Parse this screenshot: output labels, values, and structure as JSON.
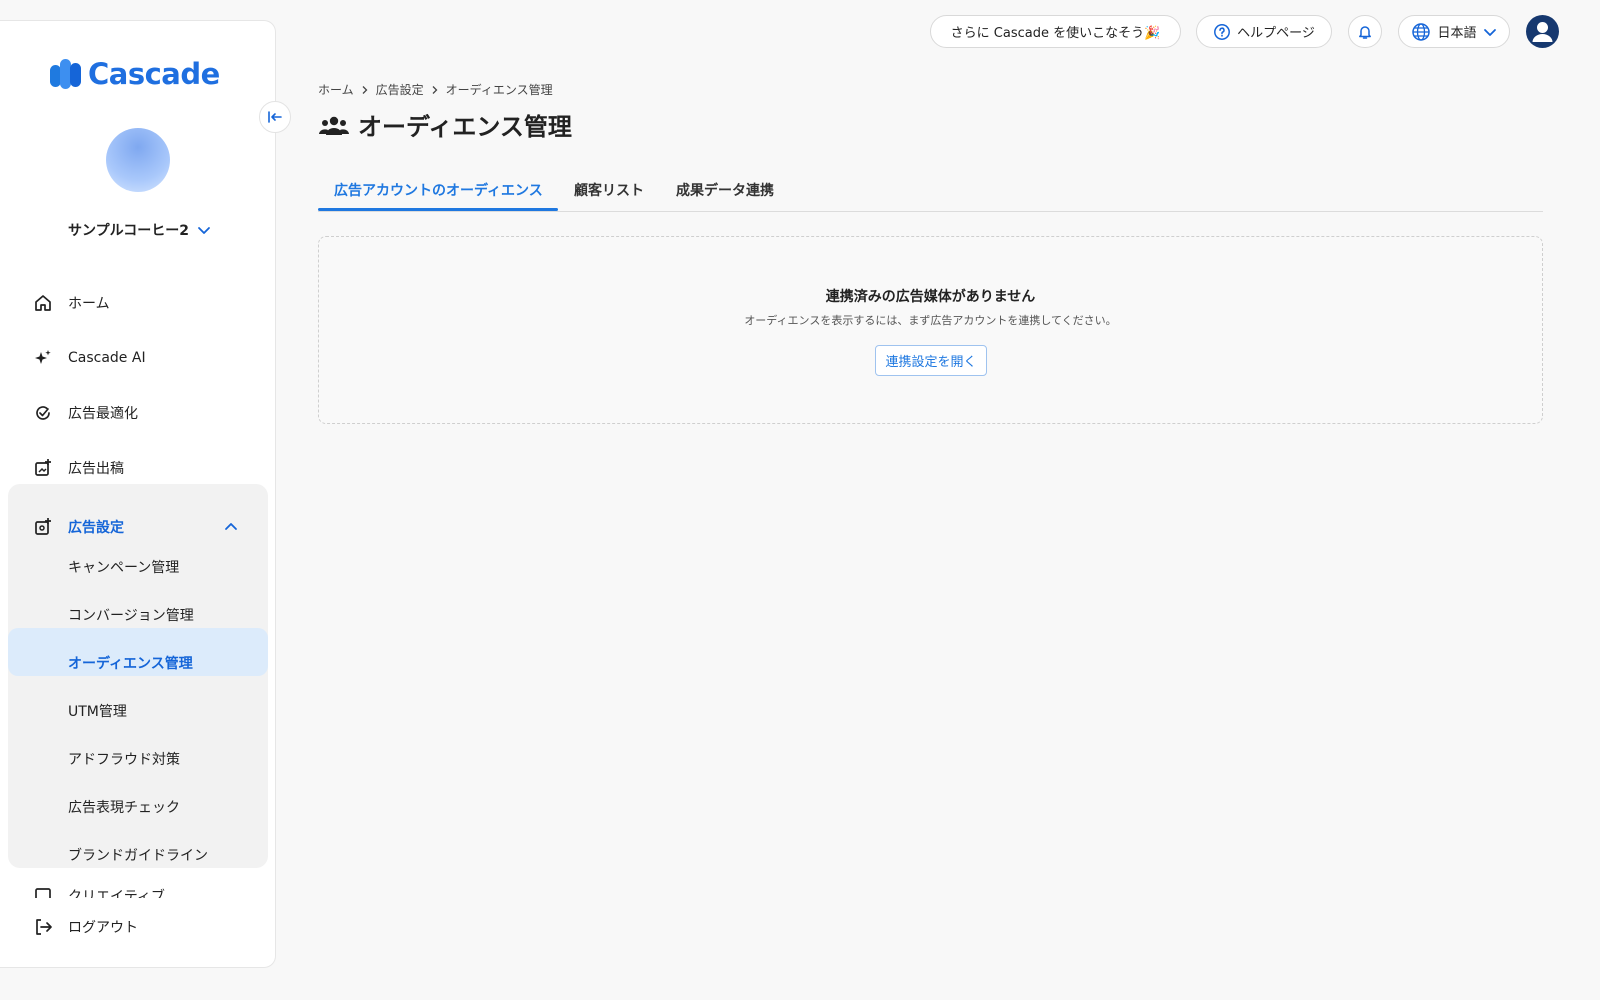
{
  "app": {
    "logo_text": "Cascade",
    "brand_color": "#1f6fe0",
    "accent": "#1f78e0"
  },
  "header": {
    "promo_label": "さらに Cascade を使いこなそう🎉",
    "help_label": "ヘルプページ",
    "language_label": "日本語"
  },
  "sidebar": {
    "org_name": "サンプルコーヒー2",
    "items": [
      {
        "label": "ホーム",
        "icon": "home-icon"
      },
      {
        "label": "Cascade AI",
        "icon": "sparkle-icon"
      },
      {
        "label": "広告最適化",
        "icon": "optimize-icon"
      },
      {
        "label": "広告出稿",
        "icon": "ad-post-icon"
      }
    ],
    "group": {
      "label": "広告設定",
      "icon": "ad-settings-icon",
      "sub_items": [
        {
          "label": "キャンペーン管理"
        },
        {
          "label": "コンバージョン管理"
        },
        {
          "label": "オーディエンス管理"
        },
        {
          "label": "UTM管理"
        },
        {
          "label": "アドフラウド対策"
        },
        {
          "label": "広告表現チェック"
        },
        {
          "label": "ブランドガイドライン"
        }
      ]
    },
    "partial_item": "クリエイティブ",
    "logout_label": "ログアウト"
  },
  "breadcrumb": [
    "ホーム",
    "広告設定",
    "オーディエンス管理"
  ],
  "page": {
    "title": "オーディエンス管理",
    "tabs": [
      {
        "label": "広告アカウントのオーディエンス",
        "active": true
      },
      {
        "label": "顧客リスト",
        "active": false
      },
      {
        "label": "成果データ連携",
        "active": false
      }
    ],
    "empty": {
      "title": "連携済みの広告媒体がありません",
      "description": "オーディエンスを表示するには、まず広告アカウントを連携してください。",
      "button": "連携設定を開く"
    }
  }
}
